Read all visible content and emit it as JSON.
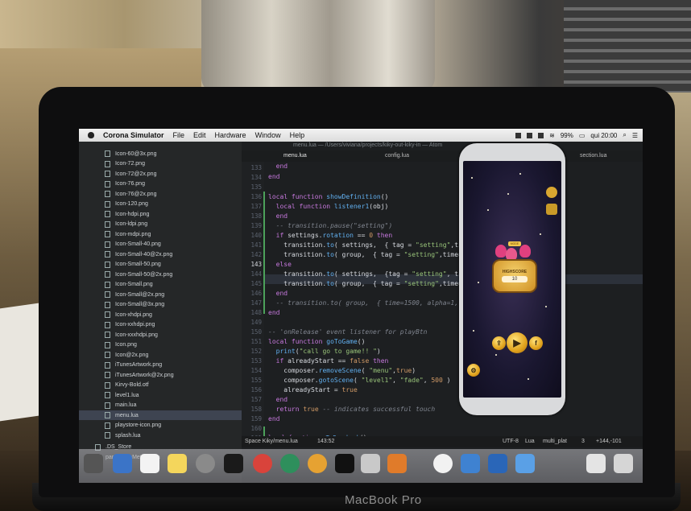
{
  "menubar": {
    "app_name": "Corona Simulator",
    "items": [
      "File",
      "Edit",
      "Hardware",
      "Window",
      "Help"
    ],
    "battery": "99%",
    "clock": "qui 20:00"
  },
  "editor": {
    "title": "menu.lua — /Users/viviana/projects/kiky-out-kiky-in — Atom",
    "tabs": [
      "menu.lua",
      "config.lua",
      "section.lua"
    ],
    "line_numbers": [
      "133",
      "134",
      "135",
      "136",
      "137",
      "138",
      "139",
      "140",
      "141",
      "142",
      "143",
      "144",
      "145",
      "146",
      "147",
      "148",
      "149",
      "150",
      "151",
      "152",
      "153",
      "154",
      "155",
      "156",
      "157",
      "158",
      "159",
      "160",
      "161"
    ],
    "current_line": "143",
    "status": {
      "file_path": "Space Kiky/menu.lua",
      "cursor": "143:52",
      "encoding": "UTF-8",
      "grammar": "Lua",
      "branch": "multi_plat",
      "count": "3",
      "diff": "+144,-101"
    }
  },
  "sidebar": {
    "files": [
      "Icon-60@3x.png",
      "Icon-72.png",
      "Icon-72@2x.png",
      "Icon-76.png",
      "Icon-76@2x.png",
      "Icon-120.png",
      "Icon-hdpi.png",
      "Icon-ldpi.png",
      "Icon-mdpi.png",
      "Icon-Small-40.png",
      "Icon-Small-40@2x.png",
      "Icon-Small-50.png",
      "Icon-Small-50@2x.png",
      "Icon-Small.png",
      "Icon-Small@2x.png",
      "Icon-Small@3x.png",
      "Icon-xhdpi.png",
      "Icon-xxhdpi.png",
      "Icon-xxxhdpi.png",
      "Icon.png",
      "Icon@2x.png",
      "iTunesArtwork.png",
      "iTunesArtwork@2x.png",
      "Kirvy-Bold.otf",
      "level1.lua",
      "main.lua",
      "menu.lua",
      "playstore-icon.png",
      "splash.lua"
    ],
    "selected": "menu.lua",
    "root_items": [
      ".DS_Store",
      "parse_httpMethod.lua"
    ]
  },
  "game": {
    "sign_text": "MODE",
    "highscore_label": "HIGHSCORE",
    "highscore_value": "10"
  },
  "laptop_brand": "MacBook Pro"
}
